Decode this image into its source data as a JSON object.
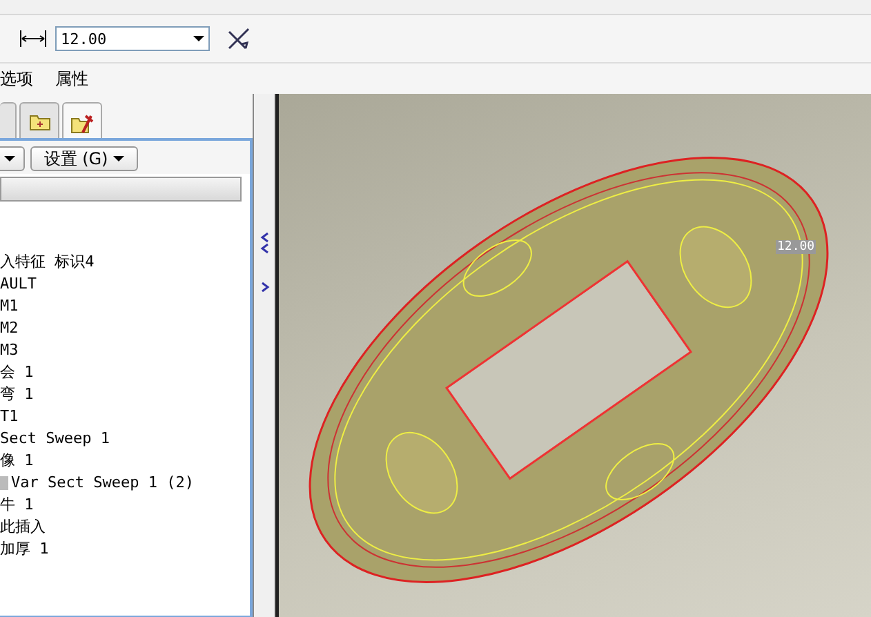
{
  "toolbar": {
    "thickness": {
      "value": "12.00"
    }
  },
  "menu": [
    "选项",
    "属性"
  ],
  "panel": {
    "tabs": [
      {
        "selected": false
      },
      {
        "selected": false
      },
      {
        "selected": true
      }
    ],
    "settings_button": "设置 (G)",
    "tree": [
      "入特征 标识4",
      "AULT",
      "M1",
      "M2",
      "M3",
      "会 1",
      "弯 1",
      "T1",
      "Sect Sweep 1",
      "像 1",
      "Var Sect Sweep 1 (2)",
      "牛 1",
      "此插入",
      "加厚 1"
    ]
  },
  "viewport": {
    "dimension_label": "12.00"
  }
}
